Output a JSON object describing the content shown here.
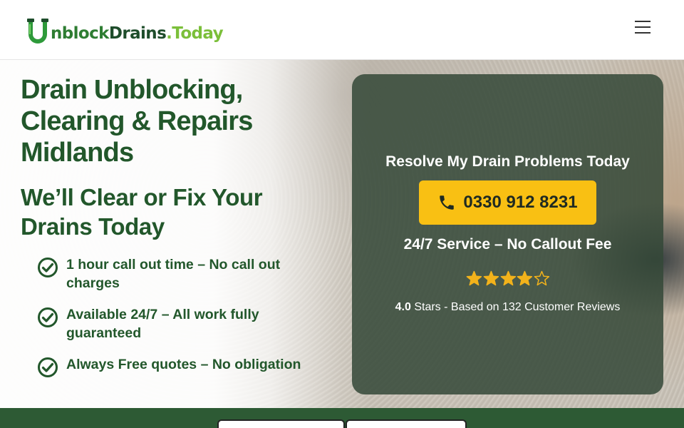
{
  "header": {
    "logo": {
      "part_u": "U",
      "part_nblock": "nblock",
      "part_drains": "Drains",
      "part_today": ".Today"
    },
    "menu_icon": "hamburger-menu-icon"
  },
  "hero": {
    "title": "Drain Unblocking, Clearing & Repairs Midlands",
    "subtitle": "We’ll Clear or Fix Your Drains Today",
    "features": [
      {
        "text": "1 hour call out time – No call out charges",
        "icon": "check-circle-icon"
      },
      {
        "text": "Available 24/7 – All work fully guaranteed",
        "icon": "check-circle-icon"
      },
      {
        "text": "Always Free quotes – No obligation",
        "icon": "check-circle-icon"
      }
    ]
  },
  "cta": {
    "heading": "Resolve My Drain Problems Today",
    "phone_number": "0330 912 8231",
    "phone_icon": "phone-icon",
    "service_line": "24/7 Service – No Callout Fee",
    "stars_filled": 4,
    "stars_total": 5,
    "rating_value": "4.0",
    "rating_text": " Stars - Based on 132 Customer Reviews"
  },
  "colors": {
    "brand_green": "#22572b",
    "band_green": "#2d5a34",
    "cta_yellow": "#f9c013",
    "star_gold": "#f2b21b"
  }
}
